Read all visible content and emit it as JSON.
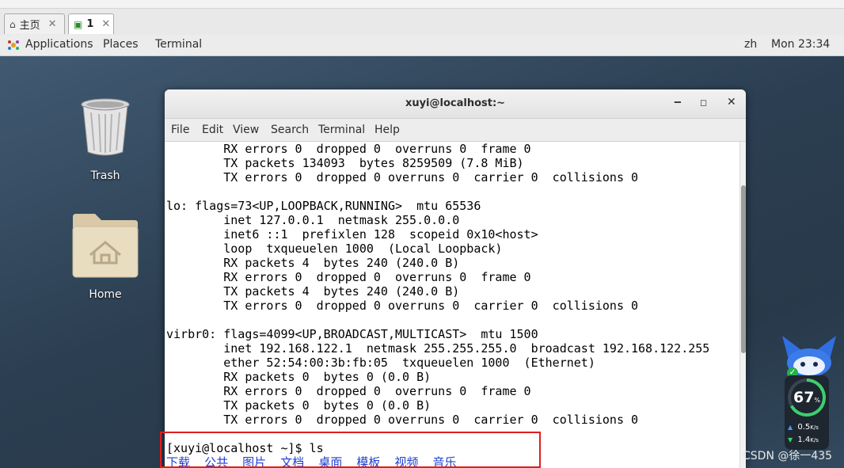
{
  "vm_tabs": [
    {
      "label": "主页",
      "icon": "home-icon"
    },
    {
      "label": "1",
      "icon": "vm-console-icon"
    }
  ],
  "gnome": {
    "applications": "Applications",
    "places": "Places",
    "terminal": "Terminal",
    "lang": "zh",
    "clock": "Mon 23:34"
  },
  "desktop": {
    "trash": "Trash",
    "home": "Home"
  },
  "terminal": {
    "title": "xuyi@localhost:~",
    "menu": [
      "File",
      "Edit",
      "View",
      "Search",
      "Terminal",
      "Help"
    ],
    "lines": [
      "        RX errors 0  dropped 0  overruns 0  frame 0",
      "        TX packets 134093  bytes 8259509 (7.8 MiB)",
      "        TX errors 0  dropped 0 overruns 0  carrier 0  collisions 0",
      "",
      "lo: flags=73<UP,LOOPBACK,RUNNING>  mtu 65536",
      "        inet 127.0.0.1  netmask 255.0.0.0",
      "        inet6 ::1  prefixlen 128  scopeid 0x10<host>",
      "        loop  txqueuelen 1000  (Local Loopback)",
      "        RX packets 4  bytes 240 (240.0 B)",
      "        RX errors 0  dropped 0  overruns 0  frame 0",
      "        TX packets 4  bytes 240 (240.0 B)",
      "        TX errors 0  dropped 0 overruns 0  carrier 0  collisions 0",
      "",
      "virbr0: flags=4099<UP,BROADCAST,MULTICAST>  mtu 1500",
      "        inet 192.168.122.1  netmask 255.255.255.0  broadcast 192.168.122.255",
      "        ether 52:54:00:3b:fb:05  txqueuelen 1000  (Ethernet)",
      "        RX packets 0  bytes 0 (0.0 B)",
      "        RX errors 0  dropped 0  overruns 0  frame 0",
      "        TX packets 0  bytes 0 (0.0 B)",
      "        TX errors 0  dropped 0 overruns 0  carrier 0  collisions 0",
      ""
    ],
    "prompt": "[xuyi@localhost ~]$ ls",
    "dirs": [
      "下载",
      "公共",
      "图片",
      "文档",
      "桌面",
      "模板",
      "视频",
      "音乐"
    ]
  },
  "widget": {
    "percent": "67",
    "percent_unit": "%",
    "up_speed": "0.5",
    "down_speed": "1.4",
    "speed_unit": "K/s"
  },
  "watermark": "CSDN @徐一435",
  "colors": {
    "dir_blue": "#1d3fd1",
    "highlight_red": "#e01e1e"
  }
}
